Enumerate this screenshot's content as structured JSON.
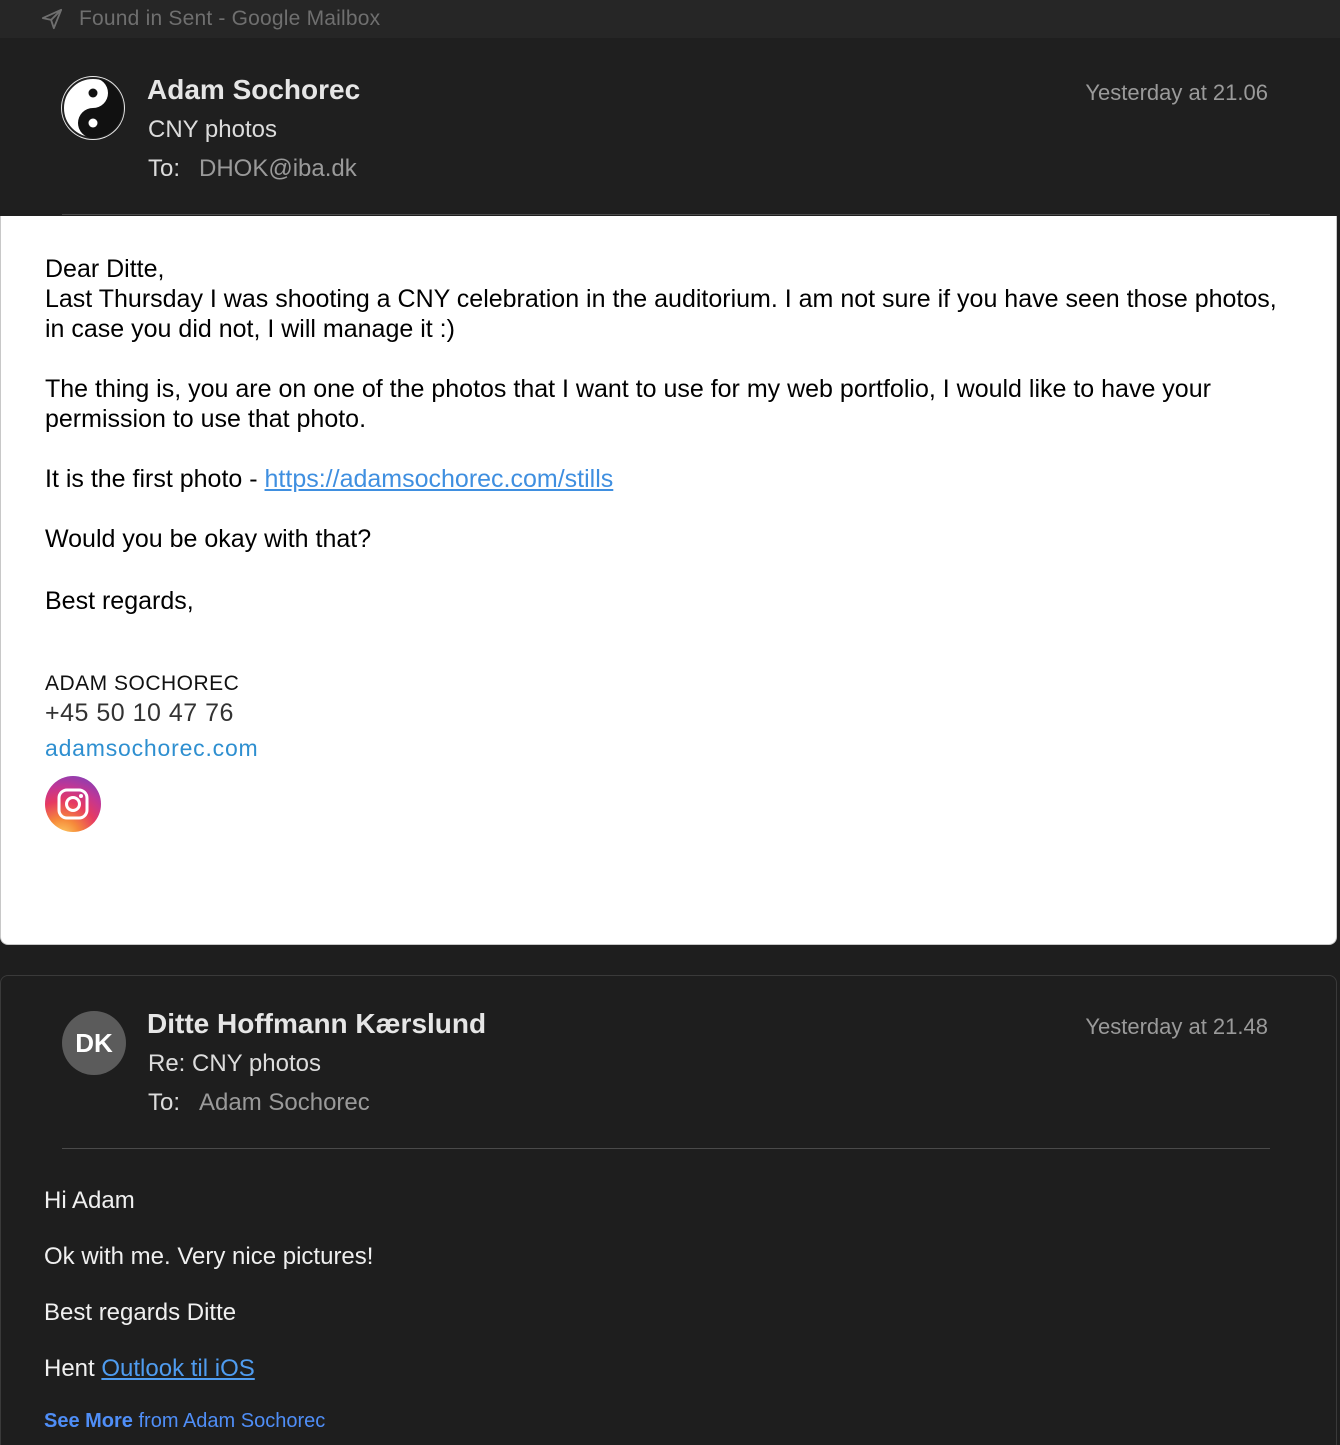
{
  "window": {
    "title": "Found in Sent - Google Mailbox",
    "sent_icon": "paper-plane-icon"
  },
  "message1": {
    "avatar_icon": "yin-yang-icon",
    "sender": "Adam Sochorec",
    "subject": "CNY photos",
    "to_label": "To:",
    "to_value": "DHOK@iba.dk",
    "time": "Yesterday at 21.06",
    "body": {
      "greeting": "Dear Ditte,",
      "para1": "Last Thursday I was shooting a CNY celebration in the auditorium. I am not sure if you have seen those photos, in case you did not, I will manage it :)",
      "para2": "The thing is, you are on one of the photos that I want to use for my web portfolio, I would like to have your permission to use that photo.",
      "para3_prefix": "It is the first photo - ",
      "para3_link": "https://adamsochorec.com/stills",
      "para4": "Would you be okay with that?",
      "closing": "Best regards,"
    },
    "signature": {
      "name": "ADAM SOCHOREC",
      "phone": "+45 50 10 47 76",
      "website": "adamsochorec.com",
      "social_icon": "instagram-icon"
    }
  },
  "message2": {
    "avatar_initials": "DK",
    "sender": "Ditte Hoffmann Kærslund",
    "subject": "Re: CNY photos",
    "to_label": "To:",
    "to_value": "Adam Sochorec",
    "time": "Yesterday at 21.48",
    "body": {
      "line1": "Hi Adam",
      "line2": "Ok with me. Very nice pictures!",
      "line3": "Best regards Ditte",
      "line4_prefix": "Hent ",
      "line4_link": "Outlook til iOS"
    },
    "see_more_bold": "See More",
    "see_more_rest": " from Adam Sochorec"
  }
}
